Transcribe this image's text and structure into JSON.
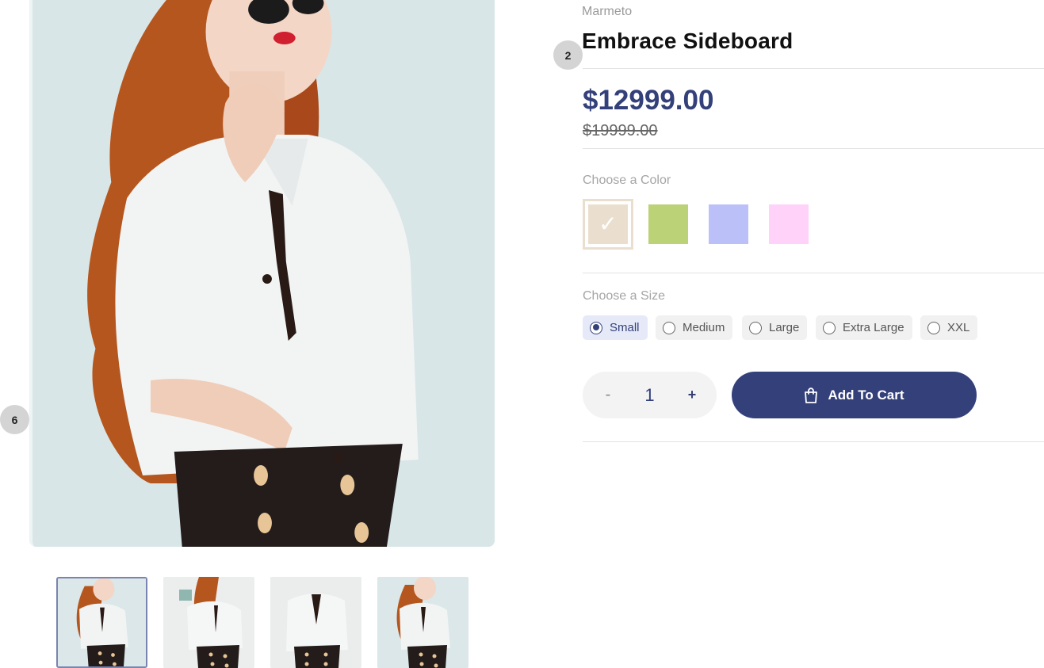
{
  "product": {
    "vendor": "Marmeto",
    "title": "Embrace Sideboard",
    "price": "$12999.00",
    "compare_price": "$19999.00"
  },
  "badges": {
    "title_step": "2",
    "gallery_step": "6"
  },
  "color_option": {
    "label": "Choose a Color",
    "selected_index": 0,
    "swatches": [
      {
        "name": "beige-swatch",
        "color": "#eadfcf"
      },
      {
        "name": "green-swatch",
        "color": "#bbd277"
      },
      {
        "name": "lavender-swatch",
        "color": "#bbc1f8"
      },
      {
        "name": "pink-swatch",
        "color": "#ffd2f9"
      }
    ],
    "check_icon": "checkmark-icon"
  },
  "size_option": {
    "label": "Choose a Size",
    "sizes": [
      {
        "label": "Small",
        "selected": true
      },
      {
        "label": "Medium",
        "selected": false
      },
      {
        "label": "Large",
        "selected": false
      },
      {
        "label": "Extra Large",
        "selected": false
      },
      {
        "label": "XXL",
        "selected": false
      }
    ]
  },
  "quantity": {
    "minus": "-",
    "value": "1",
    "plus": "+"
  },
  "cart": {
    "label": "Add To Cart",
    "icon": "shopping-bag-icon"
  },
  "colors": {
    "accent": "#34407a",
    "accent_light": "#e6eaf8"
  }
}
